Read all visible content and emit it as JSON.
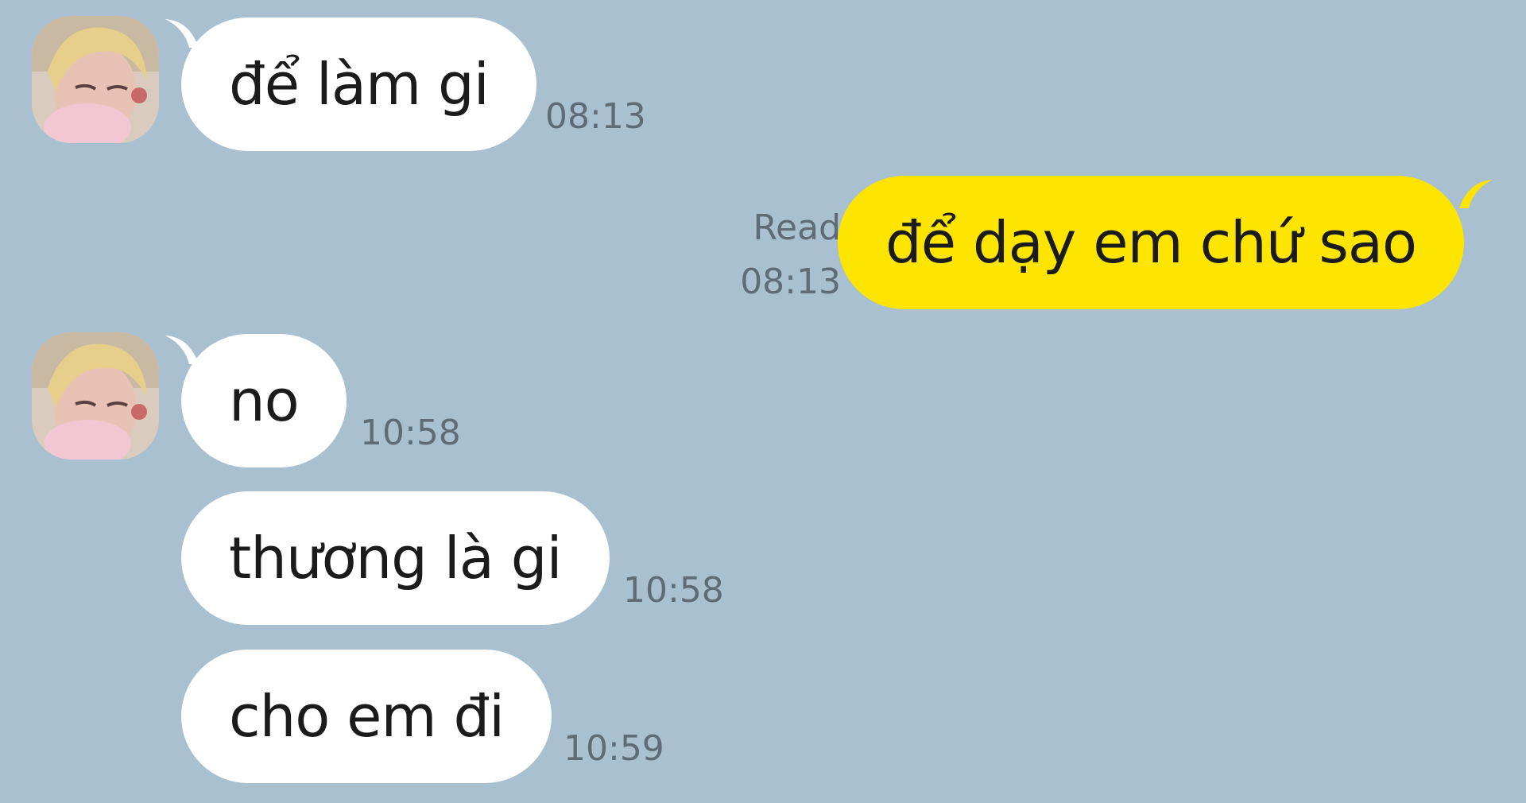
{
  "conversation": {
    "messages": [
      {
        "direction": "incoming",
        "text": "để làm gi",
        "time": "08:13"
      },
      {
        "direction": "outgoing",
        "text": "để dạy em chứ sao",
        "status": "Read",
        "time": "08:13"
      },
      {
        "direction": "incoming",
        "text": "no",
        "time": "10:58"
      },
      {
        "direction": "incoming",
        "text": "thương là gi",
        "time": "10:58"
      },
      {
        "direction": "incoming",
        "text": "cho em đi",
        "time": "10:59"
      }
    ]
  },
  "colors": {
    "background": "#a9c0d0",
    "incoming_bubble": "#ffffff",
    "outgoing_bubble": "#fee500",
    "meta_text": "#5e6c78"
  },
  "icons": {
    "avatar": "profile-photo"
  }
}
